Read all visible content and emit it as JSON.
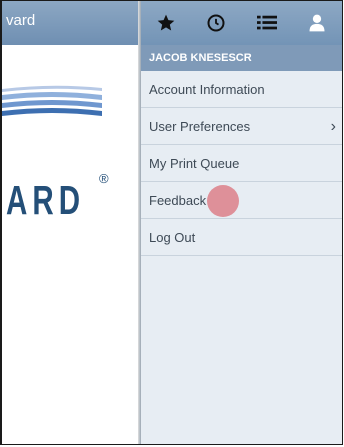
{
  "left_header": {
    "title": "vard"
  },
  "logo": {
    "text": "ARD",
    "reg_mark": "®"
  },
  "icons": [
    "star-icon",
    "clock-icon",
    "list-icon",
    "user-icon"
  ],
  "user_band": {
    "name": "JACOB KNESESCR"
  },
  "menu": {
    "items": [
      {
        "label": "Account Information"
      },
      {
        "label": "User Preferences",
        "chevron": "›"
      },
      {
        "label": "My Print Queue"
      },
      {
        "label": "Feedback"
      },
      {
        "label": "Log Out"
      }
    ]
  },
  "colors": {
    "header": "#7f9ab8",
    "menu_bg": "#e7edf3",
    "logo": "#244f78",
    "tap_indicator": "#dc7882"
  }
}
